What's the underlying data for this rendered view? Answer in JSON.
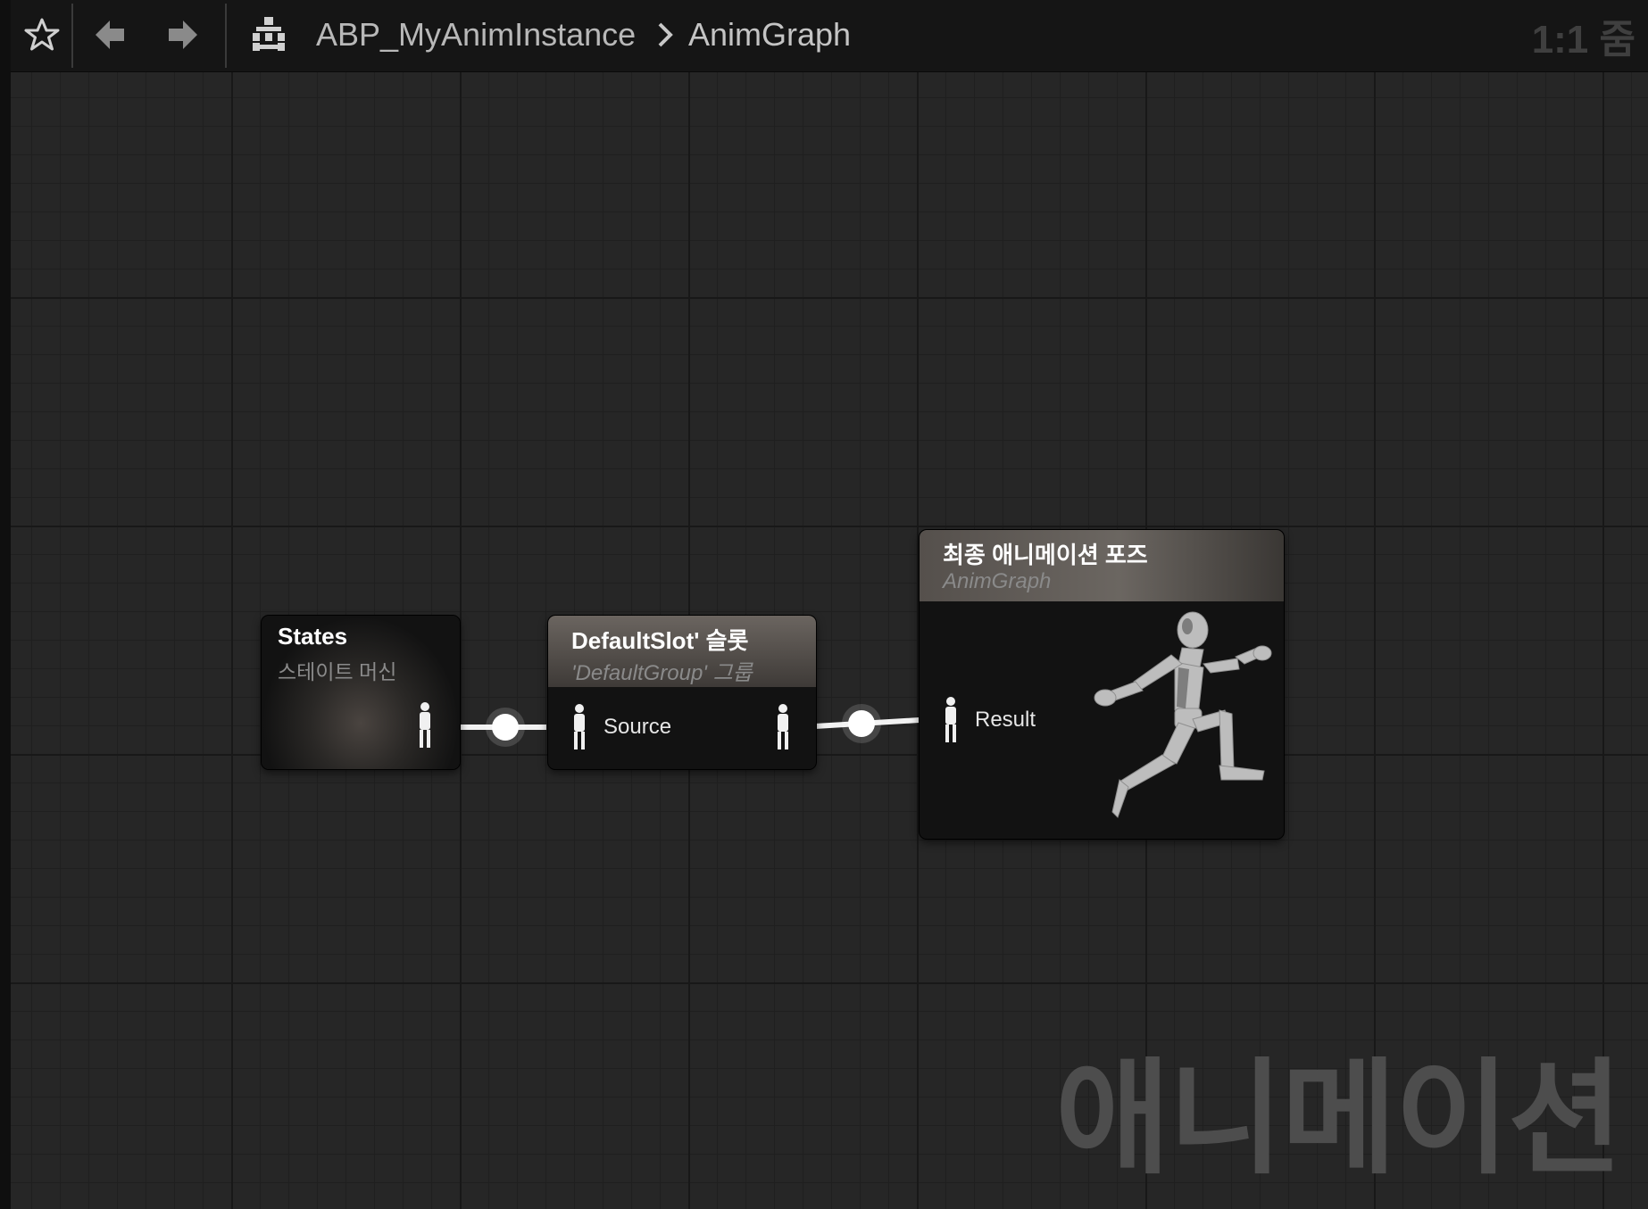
{
  "toolbar": {
    "breadcrumb_asset": "ABP_MyAnimInstance",
    "breadcrumb_graph": "AnimGraph",
    "zoom": "1:1 줌"
  },
  "nodes": {
    "states": {
      "title": "States",
      "subtitle": "스테이트 머신"
    },
    "slot": {
      "title": "DefaultSlot' 슬롯",
      "subtitle": "'DefaultGroup' 그룹",
      "input_label": "Source"
    },
    "output": {
      "title": "최종 애니메이션 포즈",
      "subtitle": "AnimGraph",
      "input_label": "Result"
    }
  },
  "watermark": "애니메이션",
  "colors": {
    "background": "#262626",
    "wire": "#ffffff",
    "node_body": "#121212"
  }
}
